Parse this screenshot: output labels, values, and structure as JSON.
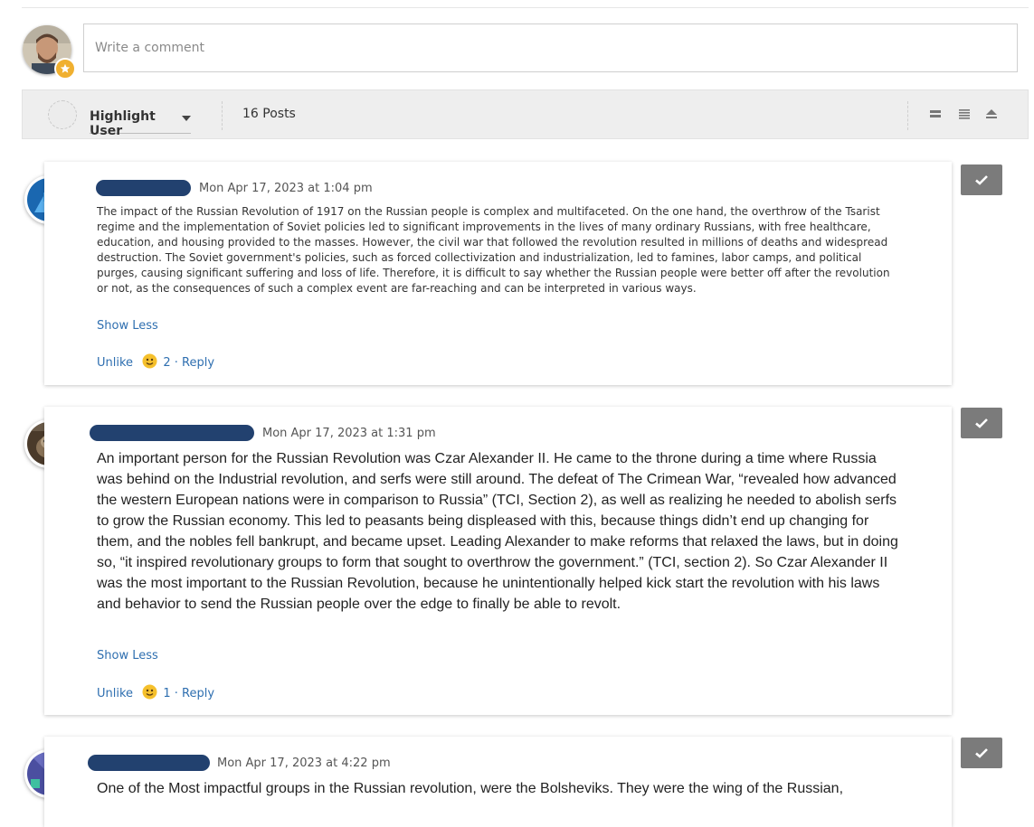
{
  "composer": {
    "placeholder": "Write a comment"
  },
  "toolbar": {
    "highlight_label": "Highlight User",
    "posts_count": "16 Posts",
    "view_icons": [
      "list-compact-icon",
      "list-expanded-icon",
      "collapse-icon"
    ]
  },
  "posts": [
    {
      "date": "Mon Apr 17, 2023 at 1:04 pm",
      "author_redacted": true,
      "body": "The impact of the Russian Revolution of 1917 on the Russian people is complex and multifaceted. On the one hand, the overthrow of the Tsarist regime and the implementation of Soviet policies led to significant improvements in the lives of many ordinary Russians, with free healthcare, education, and housing provided to the masses. However, the civil war that followed the revolution resulted in millions of deaths and widespread destruction. The Soviet government's policies, such as forced collectivization and industrialization, led to famines, labor camps, and political purges, causing significant suffering and loss of life. Therefore, it is difficult to say whether the Russian people were better off after the revolution or not, as the consequences of such a complex event are far-reaching and can be interpreted in various ways.",
      "show_less": "Show Less",
      "unlike": "Unlike",
      "likes": "2",
      "sep": "·",
      "reply": "Reply"
    },
    {
      "date": "Mon Apr 17, 2023 at 1:31 pm",
      "author_redacted": true,
      "body": "An important person for the Russian Revolution was Czar Alexander II. He came to the throne during a time where Russia was behind on the Industrial revolution, and serfs were still around. The defeat of The Crimean War, “revealed how advanced the western European nations were in comparison to Russia” (TCI, Section 2), as well as realizing he needed to abolish serfs to grow the Russian economy. This led to peasants being displeased with this, because things didn’t end up changing for them, and the nobles fell bankrupt, and became upset. Leading Alexander to make reforms that relaxed the laws, but in doing so, “it inspired revolutionary groups to form that sought to overthrow the government.” (TCI, section 2). So Czar Alexander II was the most important to the Russian Revolution, because he unintentionally helped kick start the revolution with his laws and behavior to send the Russian people over the edge to finally be able to revolt.",
      "show_less": "Show Less",
      "unlike": "Unlike",
      "likes": "1",
      "sep": "·",
      "reply": "Reply"
    },
    {
      "date": "Mon Apr 17, 2023 at 4:22 pm",
      "author_redacted": true,
      "body": "One of the Most impactful groups in the Russian revolution, were the Bolsheviks. They were the wing of the Russian,"
    }
  ],
  "colors": {
    "link": "#2f6fb0",
    "redaction": "#22416f",
    "check_button": "#7b7b7b",
    "toolbar_bg": "#eeeeee"
  }
}
